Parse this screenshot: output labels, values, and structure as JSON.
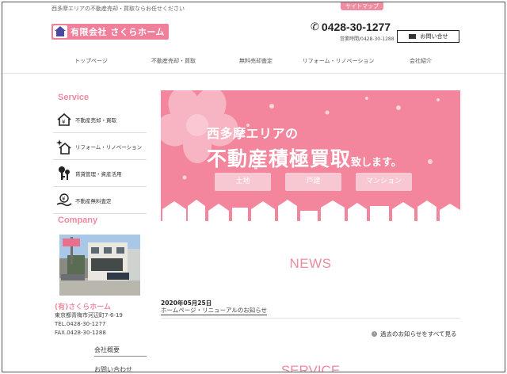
{
  "header": {
    "tagline": "西多摩エリアの不動産売却・買取ならお任せください",
    "sitemap": "サイトマップ",
    "logo_text": "有限会社 さくらホーム",
    "phone": "0428-30-1277",
    "hours": "営業時間/0428-30-1288",
    "contact": "お問い合せ"
  },
  "nav": {
    "items": [
      {
        "label": "トップページ"
      },
      {
        "label": "不動産売却・買取"
      },
      {
        "label": "無料売却査定"
      },
      {
        "label": "リフォーム・リノベーション"
      },
      {
        "label": "会社紹介"
      }
    ]
  },
  "sidebar": {
    "service_title": "Service",
    "services": [
      {
        "label": "不動産売却・買取",
        "icon": "house-yen-icon"
      },
      {
        "label": "リフォーム・リノベーション",
        "icon": "sparkle-house-icon"
      },
      {
        "label": "賃貸管理・資産活用",
        "icon": "keys-icon"
      },
      {
        "label": "不動産無料査定",
        "icon": "appraisal-icon"
      }
    ],
    "company_title": "Company",
    "company": {
      "name": "(有)さくらホーム",
      "address": "東京都青梅市河辺町7-6-19",
      "tel": "TEL.0428-30-1277",
      "fax": "FAX.0428-30-1288"
    },
    "links": [
      {
        "label": "会社概要"
      },
      {
        "label": "お問い合わせ"
      }
    ]
  },
  "banner": {
    "line1": "西多摩エリアの",
    "line2_main": "不動産積極買取",
    "line2_suffix": "致します。",
    "buttons": [
      {
        "label": "土地"
      },
      {
        "label": "戸建"
      },
      {
        "label": "マンション"
      }
    ]
  },
  "news": {
    "title": "NEWS",
    "items": [
      {
        "date": "2020年05月25日",
        "text": "ホームページ・リニューアルのお知らせ"
      }
    ],
    "more": "過去のお知らせをすべて見る"
  },
  "service_section": {
    "title": "SERVICE"
  },
  "colors": {
    "accent": "#ef8aa0",
    "banner_bg": "#f3869c",
    "pill_bg": "#f7c8d2"
  }
}
